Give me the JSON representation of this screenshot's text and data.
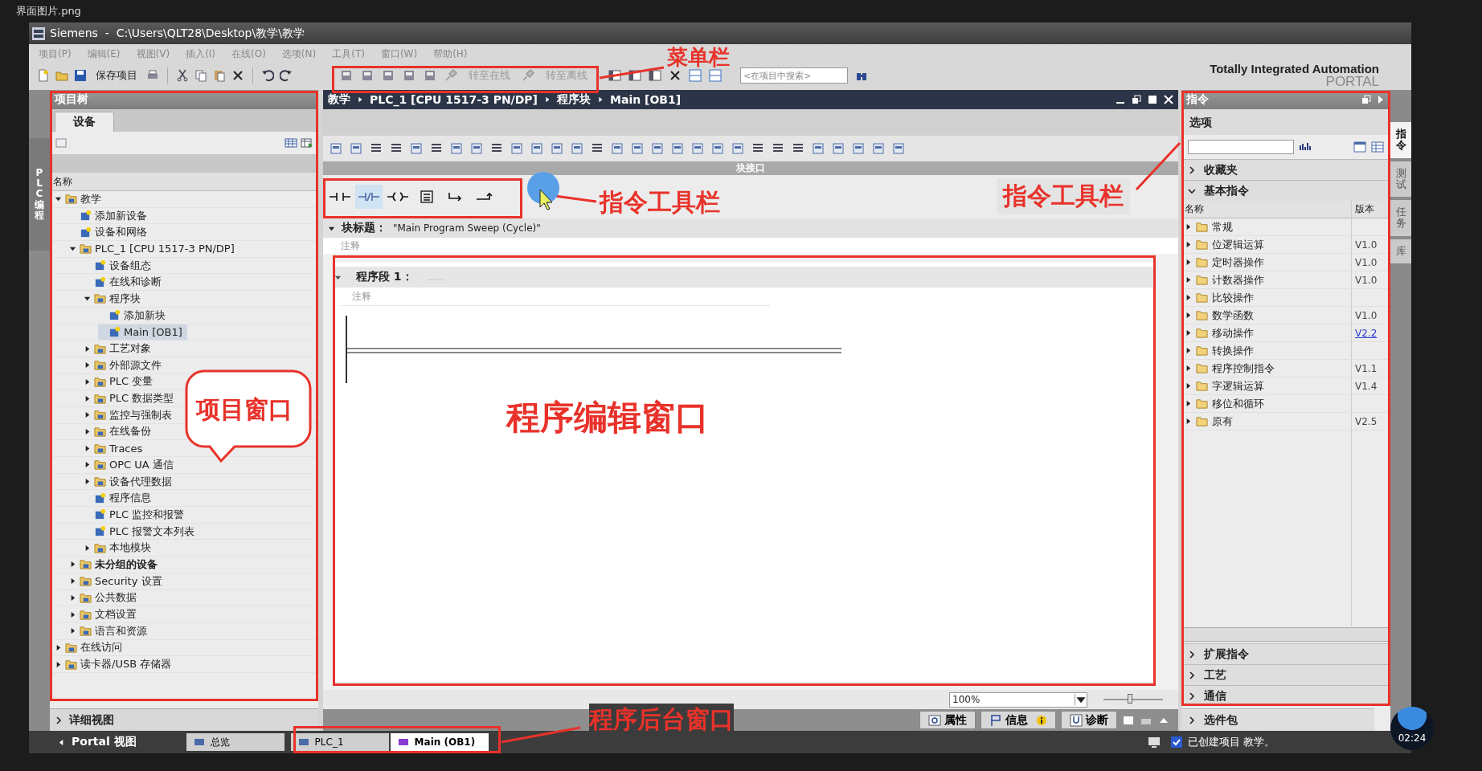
{
  "file_label": "界面图片.png",
  "window": {
    "title": "Siemens  -  C:\\Users\\QLT28\\Desktop\\教学\\教学"
  },
  "menu": [
    "项目(P)",
    "编辑(E)",
    "视图(V)",
    "插入(I)",
    "在线(O)",
    "选项(N)",
    "工具(T)",
    "窗口(W)",
    "帮助(H)"
  ],
  "toolbar": {
    "save_label": "保存项目",
    "online": [
      {
        "label": "转至在线",
        "disabled": true
      },
      {
        "label": "转至离线",
        "disabled": true
      }
    ],
    "search": {
      "placeholder": "<在项目中搜索>"
    }
  },
  "branding": {
    "line1": "Totally Integrated Automation",
    "line2": "PORTAL"
  },
  "side_tab": "PLC 编程",
  "project_tree": {
    "title": "项目树",
    "tab": "设备",
    "column": "名称",
    "items": [
      {
        "label": "教学",
        "expanded": true,
        "selected": false,
        "children": [
          {
            "label": "添加新设备",
            "selected": false
          },
          {
            "label": "设备和网络",
            "selected": false
          },
          {
            "label": "PLC_1 [CPU 1517-3 PN/DP]",
            "expanded": true,
            "selected": false,
            "children": [
              {
                "label": "设备组态",
                "selected": false
              },
              {
                "label": "在线和诊断",
                "selected": false
              },
              {
                "label": "程序块",
                "expanded": true,
                "selected": false,
                "children": [
                  {
                    "label": "添加新块",
                    "selected": false
                  },
                  {
                    "label": "Main [OB1]",
                    "selected": true
                  }
                ]
              },
              {
                "label": "工艺对象",
                "expanded": false,
                "selected": false
              },
              {
                "label": "外部源文件",
                "expanded": false,
                "selected": false
              },
              {
                "label": "PLC 变量",
                "expanded": false,
                "selected": false
              },
              {
                "label": "PLC 数据类型",
                "expanded": false,
                "selected": false
              },
              {
                "label": "监控与强制表",
                "expanded": false,
                "selected": false
              },
              {
                "label": "在线备份",
                "expanded": false,
                "selected": false
              },
              {
                "label": "Traces",
                "expanded": false,
                "selected": false
              },
              {
                "label": "OPC UA 通信",
                "expanded": false,
                "selected": false
              },
              {
                "label": "设备代理数据",
                "expanded": false,
                "selected": false
              },
              {
                "label": "程序信息",
                "selected": false
              },
              {
                "label": "PLC 监控和报警",
                "selected": false
              },
              {
                "label": "PLC 报警文本列表",
                "selected": false
              },
              {
                "label": "本地模块",
                "expanded": false,
                "selected": false
              }
            ]
          },
          {
            "label": "未分组的设备",
            "expanded": false,
            "selected": false,
            "bold": true
          },
          {
            "label": "Security 设置",
            "expanded": false,
            "selected": false
          },
          {
            "label": "公共数据",
            "expanded": false,
            "selected": false
          },
          {
            "label": "文档设置",
            "expanded": false,
            "selected": false
          },
          {
            "label": "语言和资源",
            "expanded": false,
            "selected": false
          }
        ]
      },
      {
        "label": "在线访问",
        "expanded": false,
        "selected": false
      },
      {
        "label": "读卡器/USB 存储器",
        "expanded": false,
        "selected": false
      }
    ],
    "detail_view": "详细视图"
  },
  "editor": {
    "breadcrumb": [
      "教学",
      "PLC_1 [CPU 1517-3 PN/DP]",
      "程序块",
      "Main [OB1]"
    ],
    "interface_label": "块接口",
    "instructions": [
      {
        "kind": "contact",
        "highlighted": false
      },
      {
        "kind": "negated-contact",
        "highlighted": true
      },
      {
        "kind": "coil",
        "highlighted": false
      },
      {
        "kind": "empty-box",
        "highlighted": false
      },
      {
        "kind": "open-branch",
        "highlighted": false
      },
      {
        "kind": "close-branch",
        "highlighted": false
      }
    ],
    "block_title_label": "块标题：",
    "block_title": "\"Main Program Sweep (Cycle)\"",
    "block_comment": "注释",
    "network": {
      "label": "程序段 1：",
      "title": "......",
      "comment": "注释"
    },
    "zoom": "100%",
    "zoom_slider": {
      "level": 0.45
    },
    "inspector_tabs": [
      {
        "label": "属性",
        "kind": "properties"
      },
      {
        "label": "信息",
        "kind": "info"
      },
      {
        "label": "诊断",
        "kind": "diagnostics"
      }
    ]
  },
  "instructions_panel": {
    "title": "指令",
    "options": "选项",
    "sections": [
      {
        "label": "收藏夹",
        "expanded": false
      },
      {
        "label": "基本指令",
        "expanded": true,
        "columns": [
          "名称",
          "版本"
        ],
        "rows": [
          {
            "name": "常规"
          },
          {
            "name": "位逻辑运算",
            "version": "V1.0",
            "link": false
          },
          {
            "name": "定时器操作",
            "version": "V1.0",
            "link": false
          },
          {
            "name": "计数器操作",
            "version": "V1.0",
            "link": false
          },
          {
            "name": "比较操作"
          },
          {
            "name": "数学函数",
            "version": "V1.0",
            "link": false
          },
          {
            "name": "移动操作",
            "version": "V2.2",
            "link": true
          },
          {
            "name": "转换操作"
          },
          {
            "name": "程序控制指令",
            "version": "V1.1",
            "link": false
          },
          {
            "name": "字逻辑运算",
            "version": "V1.4",
            "link": false
          },
          {
            "name": "移位和循环"
          },
          {
            "name": "原有",
            "version": "V2.5",
            "link": false
          }
        ]
      },
      {
        "label": "扩展指令",
        "expanded": false
      },
      {
        "label": "工艺",
        "expanded": false
      },
      {
        "label": "通信",
        "expanded": false
      },
      {
        "label": "选件包",
        "expanded": false
      }
    ]
  },
  "side_tabs": [
    {
      "label": "指令",
      "selected": true
    },
    {
      "label": "测试",
      "selected": false
    },
    {
      "label": "任务",
      "selected": false
    },
    {
      "label": "库",
      "selected": false
    }
  ],
  "taskbar": {
    "portal": "Portal 视图",
    "tabs": [
      {
        "label": "总览",
        "selected": false
      },
      {
        "label": "PLC_1",
        "selected": false
      },
      {
        "label": "Main (OB1)",
        "selected": true
      }
    ],
    "status": "已创建项目 教学。"
  },
  "annotations": [
    "菜单栏",
    "指令工具栏",
    "指令工具栏",
    "项目窗口",
    "程序编辑窗口",
    "程序后台窗口"
  ],
  "player_time": "02:24"
}
